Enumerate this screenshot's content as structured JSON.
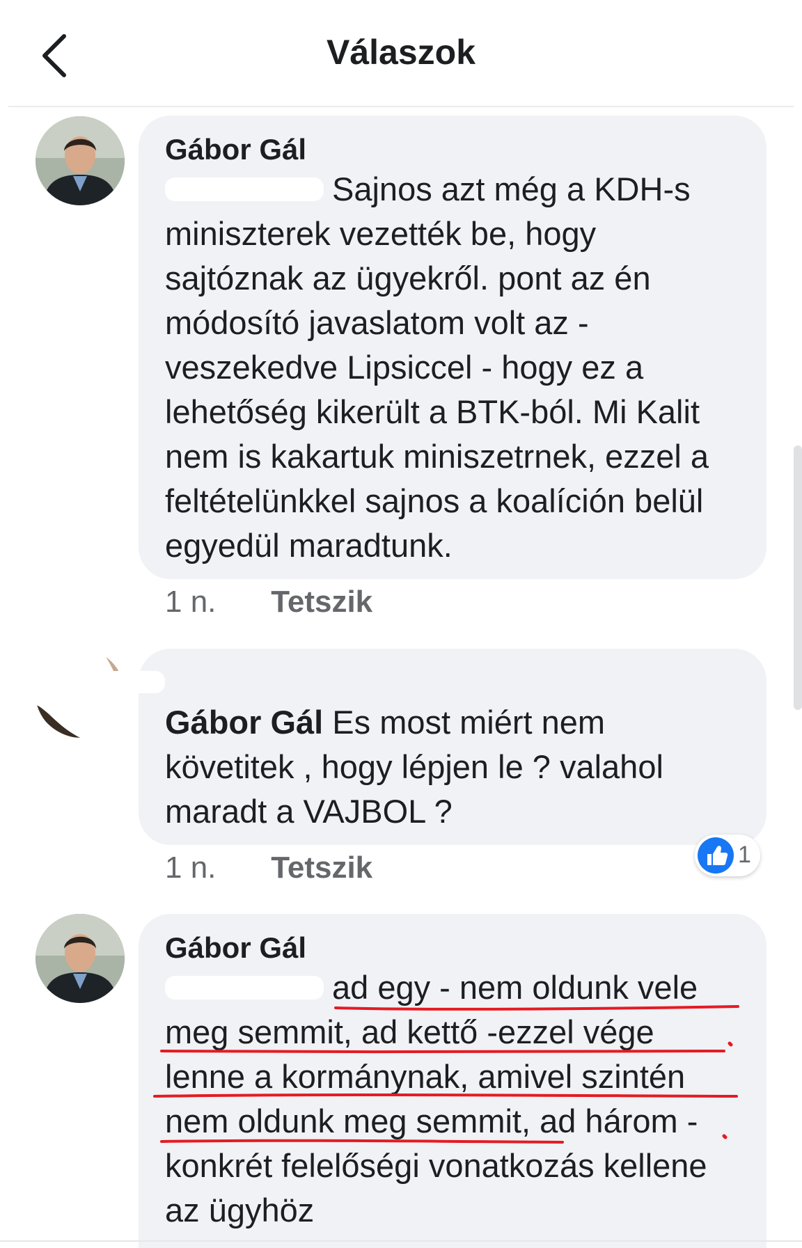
{
  "header": {
    "title": "Válaszok",
    "back_icon": "chevron-left-icon"
  },
  "comments": [
    {
      "author": "Gábor Gál",
      "text": "Sajnos azt még a KDH-s miniszterek vezették be, hogy sajtóznak az ügyekről. pont az én módosító javaslatom volt az - veszekedve Lipsiccel - hogy ez a lehetőség kikerült a BTK-ból. Mi Kalit nem is kakartuk miniszetrnek, ezzel a feltételünkkel sajnos a koalíción belül egyedül maradtunk.",
      "time": "1 n.",
      "like_label": "Tetszik"
    },
    {
      "author": "",
      "mention": "Gábor Gál",
      "text": "Es most miért nem követitek , hogy lépjen le ? valahol maradt a VAJBOL ?",
      "time": "1 n.",
      "like_label": "Tetszik",
      "reaction_count": "1",
      "reaction_icon": "thumbs-up-icon"
    },
    {
      "author": "Gábor Gál",
      "text": "ad egy - nem oldunk vele meg semmit, ad kettő -ezzel vége lenne a kormánynak, amivel szintén nem oldunk meg semmit, ad három - konkrét felelőségi vonatkozás kellene az ügyhöz"
    }
  ],
  "colors": {
    "bubble": "#f0f2f5",
    "accent": "#1877f2",
    "underline": "#e41b23",
    "meta": "#65676b"
  }
}
